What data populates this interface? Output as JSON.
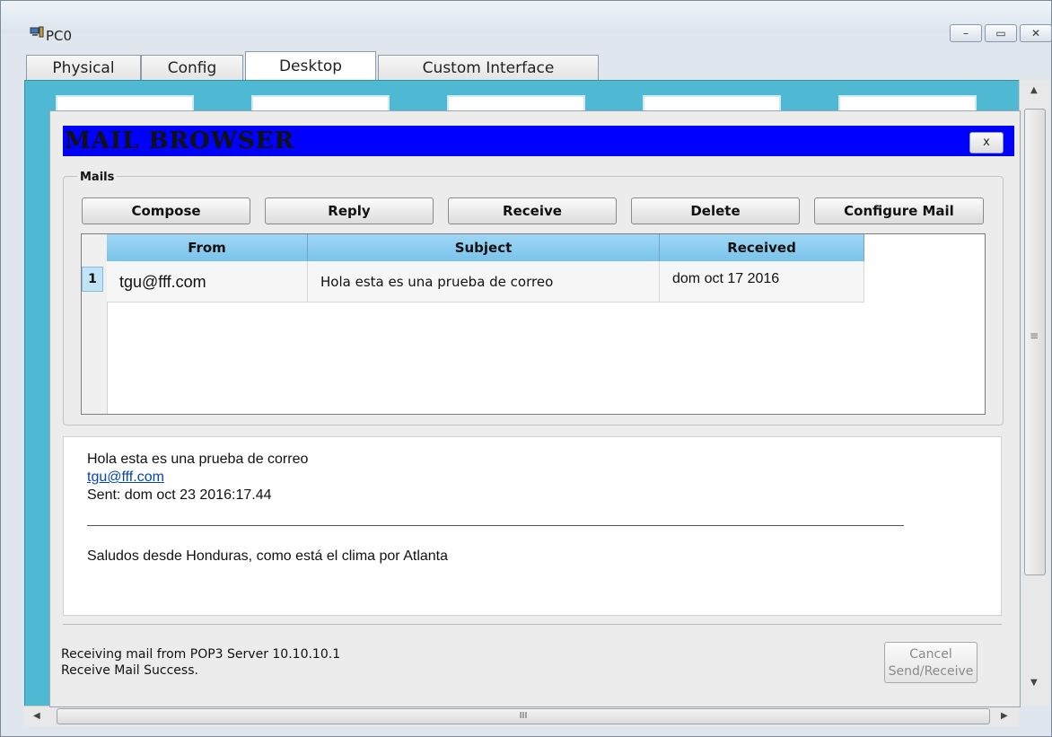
{
  "window": {
    "title": "PC0",
    "minimize_label": "–",
    "maximize_label": "▭",
    "close_label": "✕"
  },
  "tabs": [
    {
      "label": "Physical"
    },
    {
      "label": "Config"
    },
    {
      "label": "Desktop",
      "active": true
    },
    {
      "label": "Custom Interface"
    }
  ],
  "mail_browser": {
    "title": "MAIL BROWSER",
    "close_label": "x",
    "group_label": "Mails",
    "buttons": {
      "compose": "Compose",
      "reply": "Reply",
      "receive": "Receive",
      "delete": "Delete",
      "configure": "Configure Mail"
    },
    "table": {
      "headers": {
        "from": "From",
        "subject": "Subject",
        "received": "Received"
      },
      "rows": [
        {
          "num": "1",
          "from": "tgu@fff.com",
          "subject": "Hola esta es una prueba de correo",
          "received": "dom oct 17 2016"
        }
      ]
    },
    "preview": {
      "subject": "Hola esta es una prueba de correo",
      "sender": "tgu@fff.com",
      "sent": "Sent: dom oct 23 2016:17.44",
      "body": "Saludos desde Honduras, como está el clima por Atlanta"
    },
    "status": {
      "line1": "Receiving mail from POP3 Server 10.10.10.1",
      "line2": "Receive Mail Success."
    },
    "cancel": {
      "line1": "Cancel",
      "line2": "Send/Receive"
    }
  },
  "scrollbar": {
    "h_thumb_label": "III",
    "up_arrow": "▲",
    "down_arrow": "▼",
    "left_arrow": "◀",
    "right_arrow": "▶",
    "v_grip": "≡"
  },
  "colors": {
    "desktop_bg": "#4fb9d4",
    "mail_header": "#0000ff",
    "table_header": "#79c3ea",
    "link": "#0645ad"
  },
  "icons": [
    "pc-icon",
    "minimize-icon",
    "maximize-icon",
    "close-icon"
  ]
}
